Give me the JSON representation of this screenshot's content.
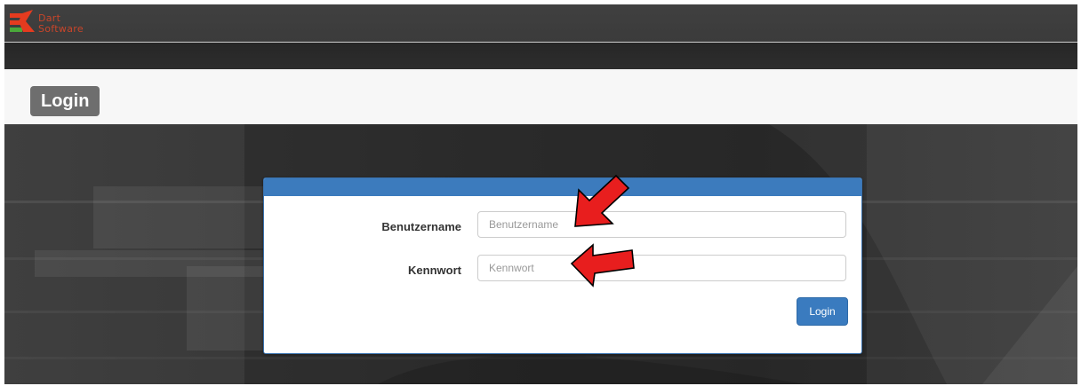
{
  "header": {
    "logo_text_line1": "Dart",
    "logo_text_line2": "Software",
    "logo_colors": {
      "red": "#e53b1f",
      "green": "#4aa83a",
      "text": "#c9452a"
    }
  },
  "page": {
    "title": "Login"
  },
  "form": {
    "username": {
      "label": "Benutzername",
      "placeholder": "Benutzername",
      "value": ""
    },
    "password": {
      "label": "Kennwort",
      "placeholder": "Kennwort",
      "value": ""
    },
    "submit_label": "Login"
  },
  "annotations": {
    "arrow_color": "#e81e1e",
    "arrow_icon": "red-arrow-icon"
  },
  "colors": {
    "accent": "#3c7bbd",
    "header_bg": "#3e3e3e",
    "title_badge": "#6e6e6e"
  }
}
